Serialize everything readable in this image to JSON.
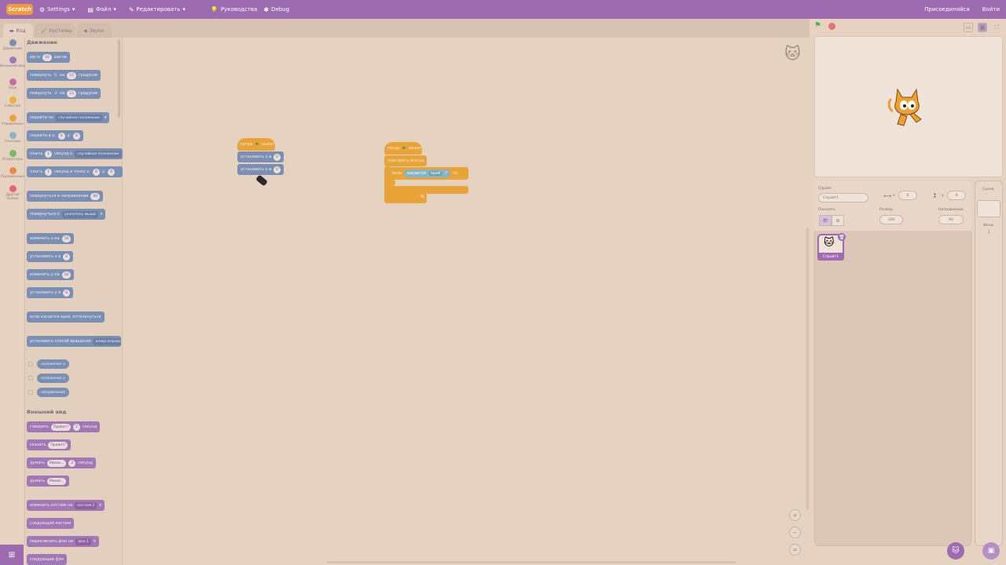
{
  "menubar": {
    "logo": "Scratch",
    "settings": "Settings",
    "file": "Файл",
    "edit": "Редактировать",
    "tutorials": "Руководства",
    "debug": "Debug",
    "join": "Присоединяйся",
    "signin": "Войти"
  },
  "tabs": {
    "code": "Код",
    "costumes": "Костюмы",
    "sounds": "Звуки"
  },
  "categories": [
    {
      "label": "Движение",
      "color": "#7b8fb5"
    },
    {
      "label": "Внешний вид",
      "color": "#a277b5"
    },
    {
      "label": "Звук",
      "color": "#c56dab"
    },
    {
      "label": "События",
      "color": "#e8b23c"
    },
    {
      "label": "Управление",
      "color": "#e8a339"
    },
    {
      "label": "Сенсоры",
      "color": "#84b7c6"
    },
    {
      "label": "Операторы",
      "color": "#7bb865"
    },
    {
      "label": "Переменные",
      "color": "#e88a4a"
    },
    {
      "label": "Другие блоки",
      "color": "#e86670"
    }
  ],
  "palette": {
    "motion_title": "Движение",
    "looks_title": "Внешний вид",
    "move": {
      "a": "идти",
      "v": "10",
      "b": "шагов"
    },
    "turn_right": {
      "a": "повернуть",
      "b": "на",
      "v": "15",
      "c": "градусов"
    },
    "turn_left": {
      "a": "повернуть",
      "b": "на",
      "v": "15",
      "c": "градусов"
    },
    "goto": {
      "a": "перейти на",
      "dd": "случайное положение"
    },
    "goto_xy": {
      "a": "перейти в x:",
      "x": "0",
      "b": "y:",
      "y": "0"
    },
    "glide": {
      "a": "плыть",
      "v": "1",
      "b": "секунд к",
      "dd": "случайное положение"
    },
    "glide_xy": {
      "a": "плыть",
      "v": "1",
      "b": "секунд в точку x:",
      "x": "0",
      "c": "y:",
      "y": "0"
    },
    "point_dir": {
      "a": "повернуться в направлении",
      "v": "90"
    },
    "point_to": {
      "a": "повернуться к",
      "dd": "указатель мыши"
    },
    "change_x": {
      "a": "изменить х на",
      "v": "10"
    },
    "set_x": {
      "a": "установить x в",
      "v": "0"
    },
    "change_y": {
      "a": "изменить у на",
      "v": "10"
    },
    "set_y": {
      "a": "установить у в",
      "v": "0"
    },
    "bounce": "если касается края, оттолкнуться",
    "rotation": {
      "a": "установить способ вращения",
      "dd": "влево-вправо"
    },
    "rep_x": "положение x",
    "rep_y": "положение у",
    "rep_dir": "направление",
    "say_for": {
      "a": "говорить",
      "v": "Привет!",
      "n": "2",
      "b": "секунд"
    },
    "say": {
      "a": "сказать",
      "v": "Привет!"
    },
    "think_for": {
      "a": "думать",
      "v": "Мммм...",
      "n": "2",
      "b": "секунд"
    },
    "think": {
      "a": "думать",
      "v": "Мммм..."
    },
    "costume": {
      "a": "изменить костюм на",
      "dd": "костюм 2"
    },
    "next_costume": "следующий костюм",
    "backdrop": {
      "a": "переключить фон на",
      "dd": "фон 1"
    },
    "next_backdrop": "следующий фон"
  },
  "script1": {
    "hat": {
      "a": "когда",
      "b": "нажат"
    },
    "set_x": {
      "a": "установить x в",
      "v": "0"
    },
    "set_y": {
      "a": "установить y в",
      "v": "0"
    }
  },
  "script2": {
    "hat": {
      "a": "когда",
      "b": "нажат"
    },
    "forever": "повторять всегда",
    "if": {
      "a": "если",
      "b": "касается",
      "dd": "край",
      "c": "?",
      "d": "то"
    }
  },
  "sprite_info": {
    "sprite_label": "Спрайт",
    "sprite_name": "Спрайт1",
    "x_label": "x",
    "x": "0",
    "y_label": "y",
    "y": "0",
    "show_label": "Показать",
    "size_label": "Размер",
    "size": "100",
    "dir_label": "Направление",
    "dir": "90",
    "thumb_label": "Спрайт1"
  },
  "stage_pane": {
    "title": "Сцена",
    "backdrops_label": "Фоны",
    "backdrops_count": "1"
  }
}
